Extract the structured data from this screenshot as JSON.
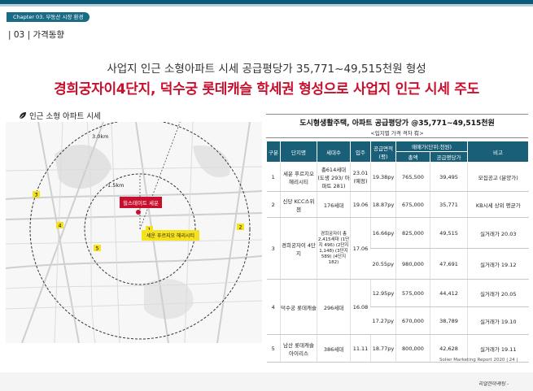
{
  "chapter": "Chapter 03. 부동산 시장 환경",
  "section_title": "| 03 | 가격동향",
  "sub_headline": "사업지 인근 소형아파트 시세 공급평당가 35,771~49,515천원 형성",
  "main_headline": "경희궁자이4단지, 덕수궁 롯데캐슬 학세권 형성으로 사업지 인근 시세 주도",
  "map_section_label": "인근 소형 아파트 시세",
  "map": {
    "radius_outer": "3.0km",
    "radius_inner": "1.5km",
    "site_label": "힐스테이트 세운",
    "complex_label": "세운 푸르지오 헤리시티",
    "markers": [
      "1",
      "2",
      "3",
      "4",
      "5"
    ]
  },
  "table_title": "도시형생활주택, 아파트 공급평당가 @35,771~49,515천원",
  "table_subtitle": "<입지별 가격 격차 有>",
  "table": {
    "headers": {
      "no": "구분",
      "name": "단지명",
      "units": "세대수",
      "move_in": "입주",
      "area": "공급면적(평)",
      "price_group": "매매가(단위:천원)",
      "total": "총액",
      "per_pyeong": "공급평당가",
      "note": "비고"
    },
    "rows": [
      {
        "no": "1",
        "name": "세운 푸르지오 헤리시티",
        "units": "총614세대 (도생 293/ 아파트 281)",
        "move_in": "23.01 (예정)",
        "area": "19.38py",
        "total": "765,500",
        "per_pyeong": "39,495",
        "note": "모집공고 (분양가)"
      },
      {
        "no": "2",
        "name": "신당 KCC스위첸",
        "units": "176세대",
        "move_in": "19.06",
        "area": "18.87py",
        "total": "675,000",
        "per_pyeong": "35,771",
        "note": "KB시세 상위 평균가"
      },
      {
        "no": "3",
        "name": "경희궁자이 4단지",
        "units": "경희궁자이 총 2,415세대 (1단지 496) (2단지 1,148) (3단지 589) (4단지 182)",
        "move_in": "17.06",
        "area": "16.66py",
        "total": "825,000",
        "per_pyeong": "49,515",
        "note": "실거래가 20.03"
      },
      {
        "no": "",
        "name": "",
        "units": "",
        "move_in": "",
        "area": "20.55py",
        "total": "980,000",
        "per_pyeong": "47,691",
        "note": "실거래가 19.12"
      },
      {
        "no": "4",
        "name": "덕수궁 롯데캐슬",
        "units": "296세대",
        "move_in": "16.08",
        "area": "12.95py",
        "total": "575,000",
        "per_pyeong": "44,412",
        "note": "실거래가 20.05"
      },
      {
        "no": "",
        "name": "",
        "units": "",
        "move_in": "",
        "area": "17.27py",
        "total": "670,000",
        "per_pyeong": "38,789",
        "note": "실거래가 19.10"
      },
      {
        "no": "5",
        "name": "남산 롯데캐슬 아이리스",
        "units": "386세대",
        "move_in": "11.11",
        "area": "18.77py",
        "total": "800,000",
        "per_pyeong": "42,628",
        "note": "실거래가 19.11"
      }
    ]
  },
  "footer": "Solier Marketing Report 2020 | 24 |",
  "brand": "리얼한마케팅 -"
}
